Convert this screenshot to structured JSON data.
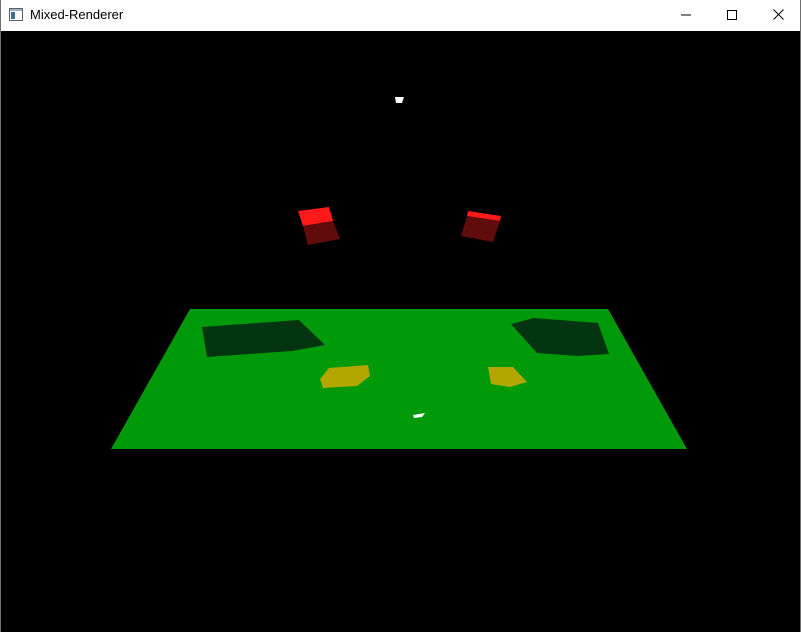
{
  "window": {
    "title": "Mixed-Renderer"
  },
  "icons": {
    "app": "app-window-icon",
    "minimize": "minimize-icon",
    "maximize": "maximize-icon",
    "close": "close-icon"
  },
  "scene": {
    "background": "#000000",
    "ground_color": "#00990a",
    "shadow_color": "#033510",
    "patch_color": "#b3a600",
    "cube_top_color": "#ff1a1a",
    "cube_side_color": "#600c0c",
    "light_color": "#ffffff"
  }
}
